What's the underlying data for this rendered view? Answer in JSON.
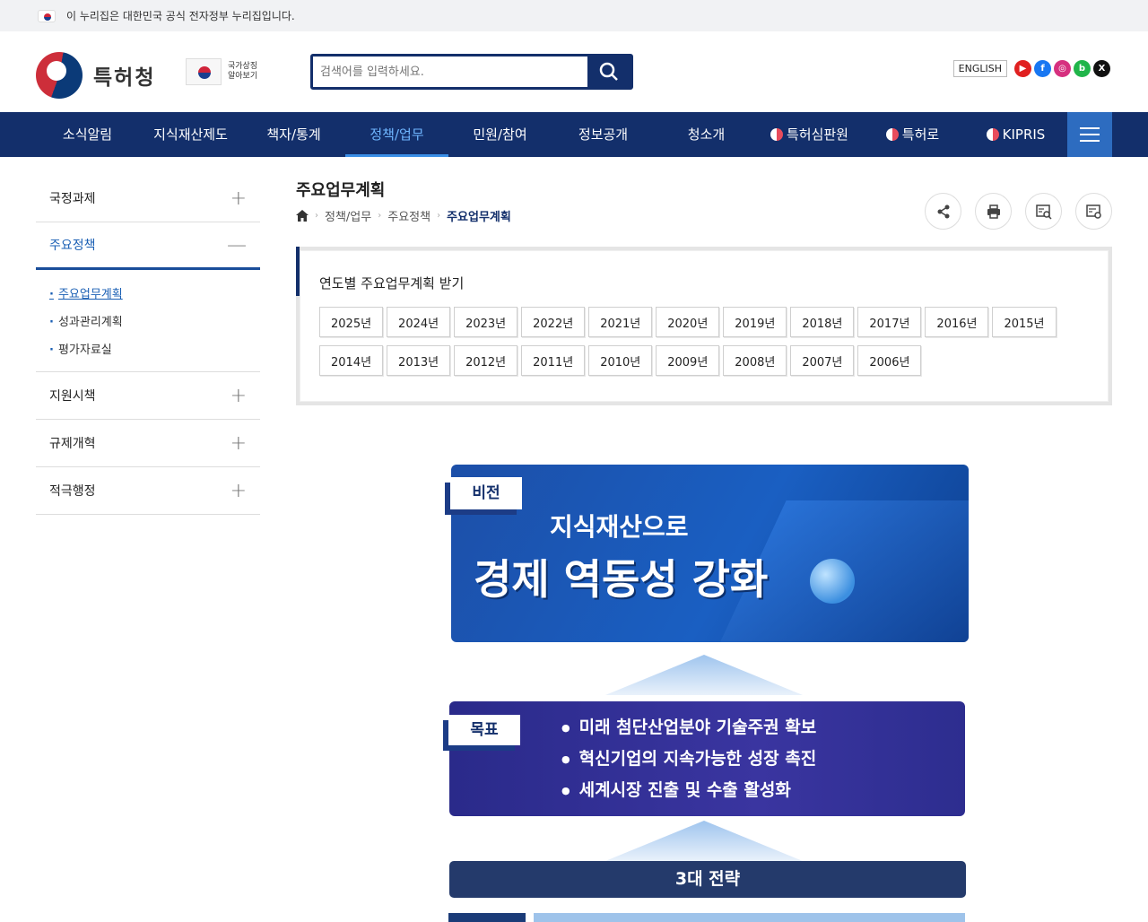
{
  "topbar": {
    "notice": "이 누리집은 대한민국 공식 전자정부 누리집입니다."
  },
  "header": {
    "logo_text": "특허청",
    "national_symbol_text": "국가상징 알아보기",
    "search_placeholder": "검색어를 입력하세요.",
    "english_label": "ENGLISH"
  },
  "gnb": {
    "items": [
      "소식알림",
      "지식재산제도",
      "책자/통계",
      "정책/업무",
      "민원/참여",
      "정보공개",
      "청소개",
      "특허심판원",
      "특허로",
      "KIPRIS"
    ],
    "active": "정책/업무"
  },
  "lnb": {
    "groups": [
      "국정과제",
      "주요정책",
      "지원시책",
      "규제개혁",
      "적극행정"
    ],
    "subs": [
      "주요업무계획",
      "성과관리계획",
      "평가자료실"
    ]
  },
  "page": {
    "title": "주요업무계획",
    "breadcrumb": [
      "정책/업무",
      "주요정책",
      "주요업무계획"
    ]
  },
  "years": {
    "heading": "연도별 주요업무계획 받기",
    "list": [
      "2025년",
      "2024년",
      "2023년",
      "2022년",
      "2021년",
      "2020년",
      "2019년",
      "2018년",
      "2017년",
      "2016년",
      "2015년",
      "2014년",
      "2013년",
      "2012년",
      "2011년",
      "2010년",
      "2009년",
      "2008년",
      "2007년",
      "2006년"
    ]
  },
  "infographic": {
    "vision_tag": "비전",
    "vision_sub": "지식재산으로",
    "vision_main": "경제 역동성 강화",
    "goal_tag": "목표",
    "goals": [
      "미래 첨단산업분야 기술주권 확보",
      "혁신기업의 지속가능한 성장 촉진",
      "세계시장 진출 및 수출 활성화"
    ],
    "strategy_title": "3대 전략"
  },
  "colors": {
    "navy": "#132f6b",
    "accent": "#1a5fb4",
    "menu_button": "#2d6cc0"
  }
}
